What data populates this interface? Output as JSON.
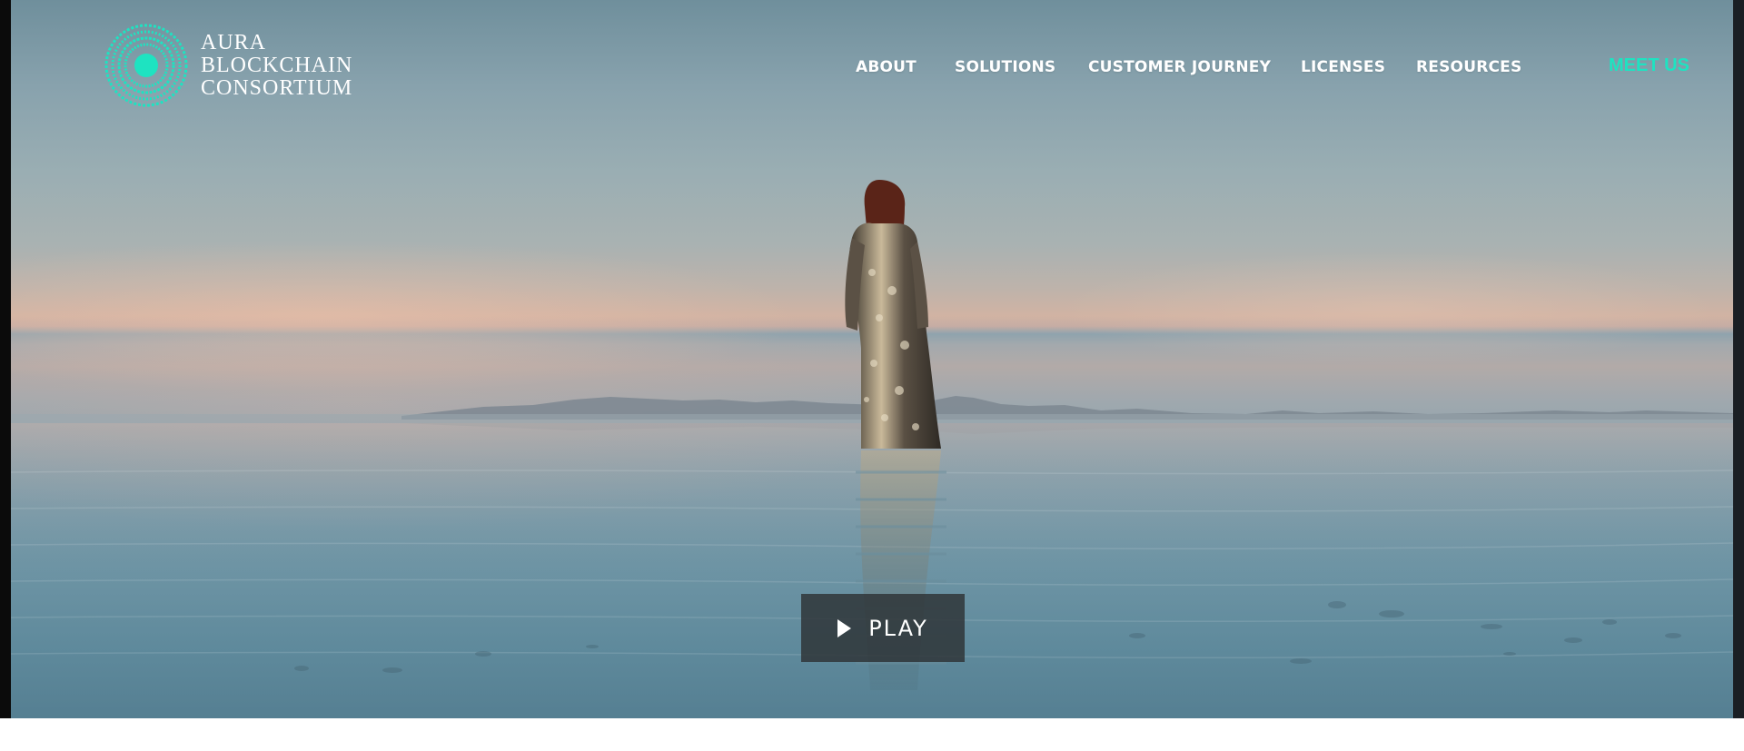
{
  "brand": {
    "logo_icon": "aura-circle-logo-icon",
    "name_lines": [
      "AURA",
      "BLOCKCHAIN",
      "CONSORTIUM"
    ],
    "accent_color": "#1ee3c1"
  },
  "nav": {
    "items": [
      {
        "label": "ABOUT"
      },
      {
        "label": "SOLUTIONS"
      },
      {
        "label": "CUSTOMER JOURNEY"
      },
      {
        "label": "LICENSES"
      },
      {
        "label": "RESOURCES"
      }
    ],
    "cta_label": "MEET US"
  },
  "hero": {
    "play_icon": "play-icon",
    "play_label": "PLAY"
  }
}
